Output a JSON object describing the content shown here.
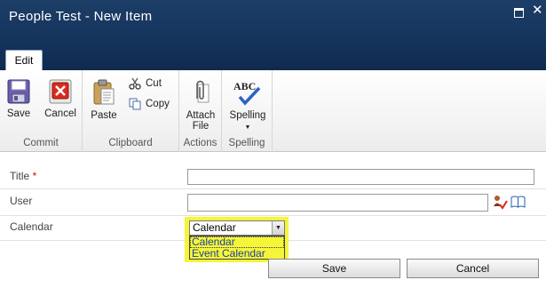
{
  "window": {
    "title": "People Test - New Item"
  },
  "tabs": [
    {
      "label": "Edit"
    }
  ],
  "ribbon": {
    "commit": {
      "label": "Commit",
      "save": "Save",
      "cancel": "Cancel"
    },
    "clipboard": {
      "label": "Clipboard",
      "paste": "Paste",
      "cut": "Cut",
      "copy": "Copy"
    },
    "actions": {
      "label": "Actions",
      "attach_line1": "Attach",
      "attach_line2": "File"
    },
    "spelling": {
      "label": "Spelling",
      "spelling": "Spelling",
      "icon_text": "ABC"
    }
  },
  "form": {
    "title": {
      "label": "Title",
      "required_mark": " *",
      "value": ""
    },
    "user": {
      "label": "User",
      "value": ""
    },
    "calendar": {
      "label": "Calendar",
      "selected": "Calendar",
      "options": [
        "Calendar",
        "Event Calendar"
      ]
    },
    "buttons": {
      "save": "Save",
      "cancel": "Cancel"
    }
  },
  "colors": {
    "titlebar": "#173660",
    "highlight": "#f5f53a",
    "required": "#d00000"
  }
}
